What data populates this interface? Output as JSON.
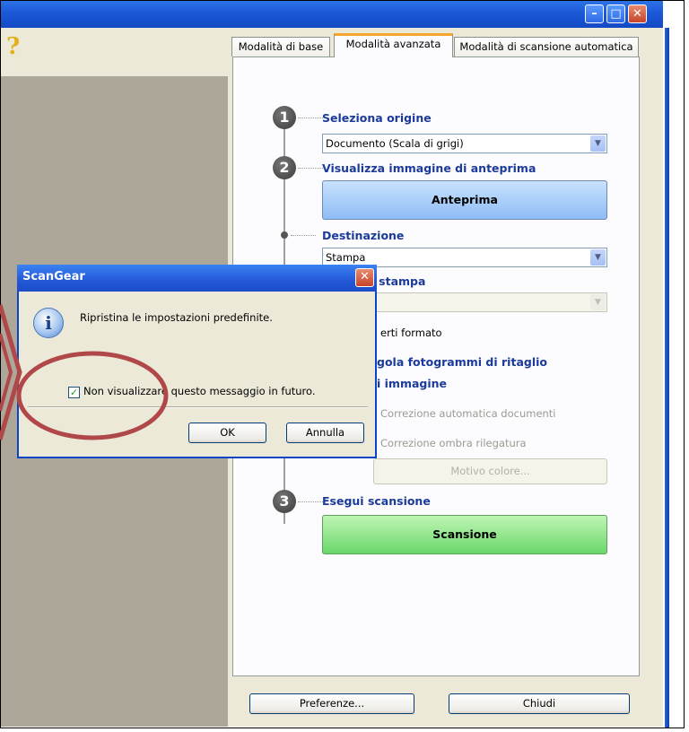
{
  "help_icon": "question-icon",
  "tabs": [
    "Modalità di base",
    "Modalità avanzata",
    "Modalità di scansione automatica"
  ],
  "steps": {
    "s1": "1",
    "s2": "2",
    "s3": "3"
  },
  "sections": {
    "source_label": "Seleziona origine",
    "source_value": "Documento (Scala di grigi)",
    "preview_label": "Visualizza immagine di anteprima",
    "preview_button": "Anteprima",
    "destination_label": "Destinazione",
    "destination_value": "Stampa",
    "print_size_label": "Formato stampa",
    "invert_format": "erti formato",
    "crop_frames": "gola fotogrammi di ritaglio",
    "image_settings": "i immagine",
    "auto_doc_fix": "Correzione automatica documenti",
    "gutter_shadow": "Correzione ombra rilegatura",
    "color_pattern": "Motivo colore...",
    "scan_label": "Esegui scansione",
    "scan_button": "Scansione"
  },
  "footer": {
    "preferences": "Preferenze...",
    "close": "Chiudi"
  },
  "dialog": {
    "title": "ScanGear",
    "message": "Ripristina le impostazioni predefinite.",
    "checkbox_label": "Non visualizzare questo messaggio in futuro.",
    "checkbox_checked": true,
    "ok": "OK",
    "cancel": "Annulla"
  },
  "colors": {
    "annotation": "#b0484a",
    "section_label": "#1b3a9b"
  }
}
